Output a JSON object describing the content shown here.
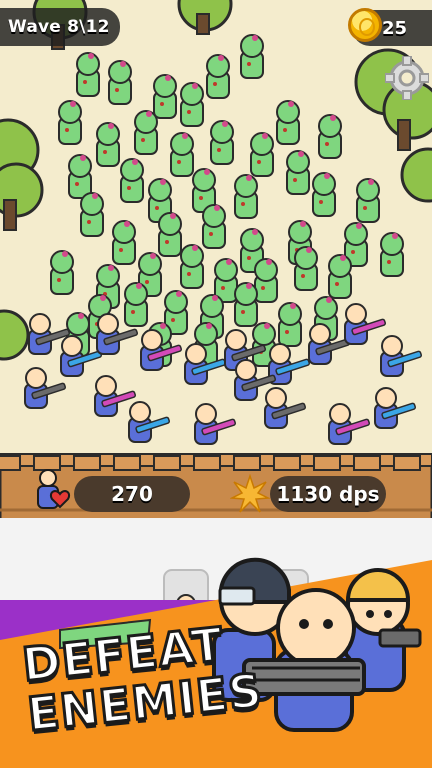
{
  "hud": {
    "wave_label": "Wave 8\\12",
    "coins": "25",
    "settings_icon": "gear-icon",
    "coin_icon": "coin-icon"
  },
  "wall": {
    "health_value": "270",
    "health_icon": "heart-icon",
    "dps_value": "1130 dps",
    "dps_icon": "explosion-icon"
  },
  "promo": {
    "line1": "DEFEAT",
    "line2": "ENEMIES"
  },
  "colors": {
    "sand": "#f4eccd",
    "wall_wood": "#c98a4b",
    "zombie_green": "#7fd67f",
    "soldier_blue": "#5a6fd8",
    "promo_orange": "#f7931e",
    "promo_purple": "#9b30c8"
  }
}
